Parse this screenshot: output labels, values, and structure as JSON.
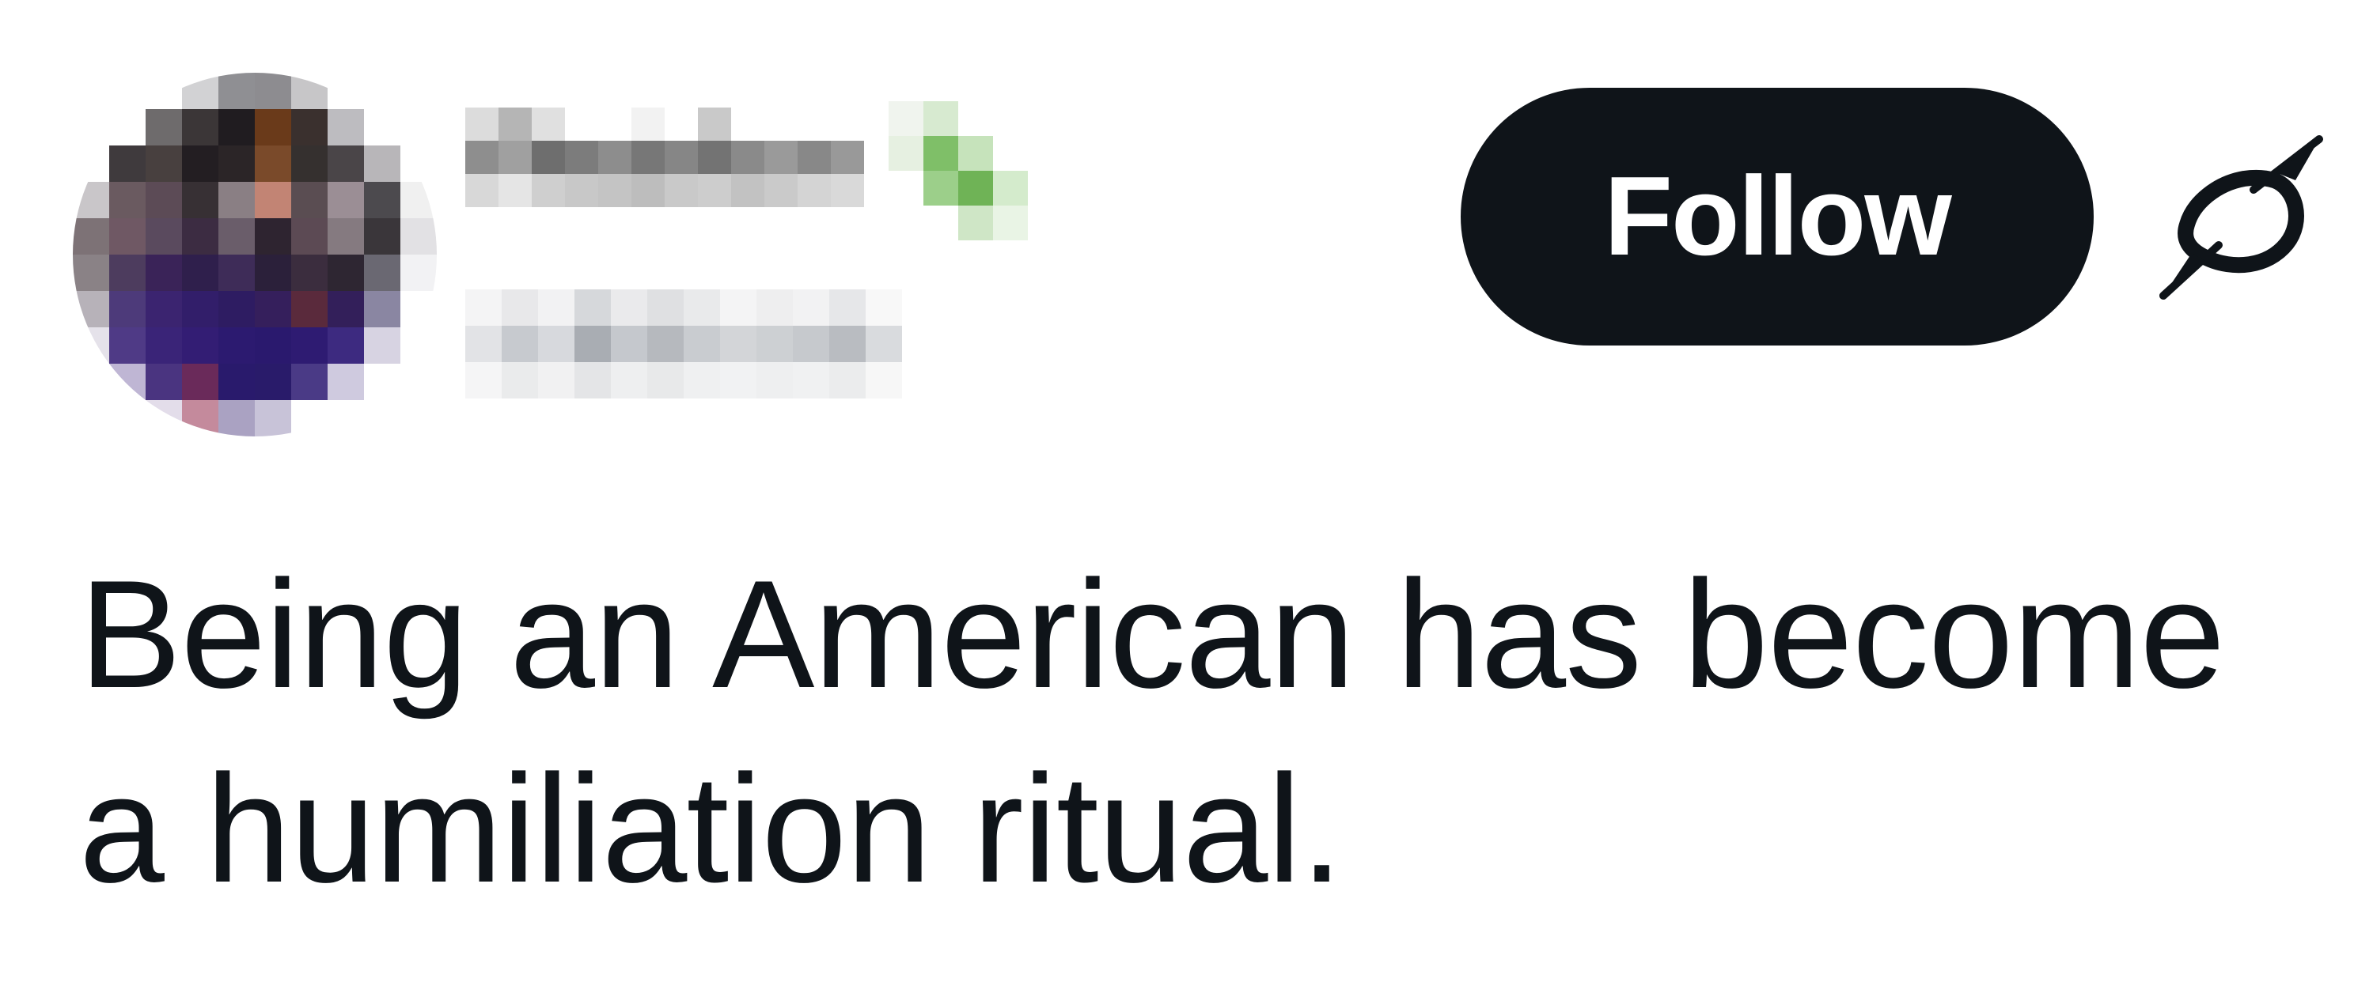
{
  "author": {
    "display_name": "",
    "handle": "",
    "avatar_pixels": [
      [
        "#ffffff",
        "#ffffff",
        "#ffffff",
        "#d2d2d4",
        "#8f8f93",
        "#8d8c90",
        "#c7c6c8",
        "#ffffff",
        "#ffffff",
        "#ffffff"
      ],
      [
        "#ffffff",
        "#ffffff",
        "#6e6b6c",
        "#3b3637",
        "#201c20",
        "#6a3a1a",
        "#3a302e",
        "#bdbcc0",
        "#ffffff",
        "#ffffff"
      ],
      [
        "#ffffff",
        "#3f3a3d",
        "#48403f",
        "#231e22",
        "#2b2527",
        "#7a4a2a",
        "#35302f",
        "#4a4548",
        "#b8b6b9",
        "#ffffff"
      ],
      [
        "#c9c6c9",
        "#6a5a60",
        "#5c4b56",
        "#373034",
        "#8a7f84",
        "#c28474",
        "#5a4d52",
        "#9b8e95",
        "#4c4a4e",
        "#f0f0f0"
      ],
      [
        "#7d7276",
        "#6f5864",
        "#5a4a5e",
        "#3c2c42",
        "#6a5d6a",
        "#2e2430",
        "#5c4a54",
        "#857a80",
        "#3a363a",
        "#e2e1e4"
      ],
      [
        "#8a8286",
        "#4d3c5e",
        "#3a2358",
        "#2f1f4c",
        "#3e2c58",
        "#2b203a",
        "#3b2d3e",
        "#2e2632",
        "#6a6872",
        "#f2f2f4"
      ],
      [
        "#b7b2b9",
        "#4d3a7a",
        "#3b2470",
        "#321e6a",
        "#2e1c62",
        "#351f5c",
        "#5a2a3c",
        "#331f5a",
        "#8a86a2",
        "#ffffff"
      ],
      [
        "#e5e2ea",
        "#4f3a86",
        "#3a2478",
        "#331d74",
        "#2c1a70",
        "#2a196e",
        "#2e1b72",
        "#3d2a80",
        "#d7d3e2",
        "#ffffff"
      ],
      [
        "#ffffff",
        "#bfb6d4",
        "#4a3480",
        "#6a2a5a",
        "#291a6c",
        "#291b6a",
        "#4a3a86",
        "#cfcadf",
        "#ffffff",
        "#ffffff"
      ],
      [
        "#ffffff",
        "#ffffff",
        "#e3ddea",
        "#c48a9c",
        "#aaa2c2",
        "#c8c3d8",
        "#ffffff",
        "#ffffff",
        "#ffffff",
        "#ffffff"
      ]
    ],
    "name_pixels": [
      [
        "#dcdcdc",
        "#b5b5b5",
        "#e0e0e0",
        "#ffffff",
        "#ffffff",
        "#f2f2f2",
        "#ffffff",
        "#c9c9c9",
        "#ffffff",
        "#ffffff",
        "#ffffff",
        "#ffffff"
      ],
      [
        "#8e8e8e",
        "#a0a0a0",
        "#6e6e6e",
        "#7c7c7c",
        "#8d8d8d",
        "#777777",
        "#868686",
        "#737373",
        "#8a8a8a",
        "#9a9a9a",
        "#888888",
        "#999999"
      ],
      [
        "#d8d8d8",
        "#e5e5e5",
        "#cfcfcf",
        "#c8c8c8",
        "#c4c4c4",
        "#bdbdbd",
        "#c9c9c9",
        "#cdcdcd",
        "#c2c2c2",
        "#cacaca",
        "#d4d4d4",
        "#d9d9d9"
      ]
    ],
    "handle_pixels": [
      [
        "#f4f4f5",
        "#e8e8ea",
        "#f2f2f3",
        "#d6d8db",
        "#eaeaec",
        "#dfe0e2",
        "#e9eaeb",
        "#f4f4f5",
        "#eeeeef",
        "#f2f2f3",
        "#e6e7e9",
        "#f8f8f8"
      ],
      [
        "#e2e3e6",
        "#c7cacf",
        "#d7d9dd",
        "#a9adb3",
        "#c5c8cd",
        "#b6b9be",
        "#c9ccd0",
        "#d3d5d8",
        "#cdd0d3",
        "#c6c9cd",
        "#b9bcc1",
        "#d9dbde"
      ],
      [
        "#f5f5f6",
        "#eaebec",
        "#f1f1f2",
        "#e4e5e7",
        "#eeeff0",
        "#e8e9ea",
        "#eff0f1",
        "#f1f2f3",
        "#eeeff0",
        "#f0f1f2",
        "#ebeced",
        "#f7f7f7"
      ]
    ],
    "badge_pixels": [
      [
        "#f0f4ee",
        "#d7ead0",
        "#ffffff",
        "#ffffff"
      ],
      [
        "#e6f0e1",
        "#7fbf68",
        "#c6e3bb",
        "#ffffff"
      ],
      [
        "#ffffff",
        "#9ccf8a",
        "#6fb356",
        "#d4ebcc"
      ],
      [
        "#ffffff",
        "#ffffff",
        "#cfe6c6",
        "#e9f4e5"
      ]
    ]
  },
  "actions": {
    "follow_label": "Follow",
    "grok_icon": "grok-icon"
  },
  "tweet": {
    "text": "Being an American has become a humiliation ritual."
  },
  "colors": {
    "text": "#0f1419",
    "button_bg": "#0f1419",
    "button_text": "#ffffff",
    "background": "#ffffff"
  }
}
